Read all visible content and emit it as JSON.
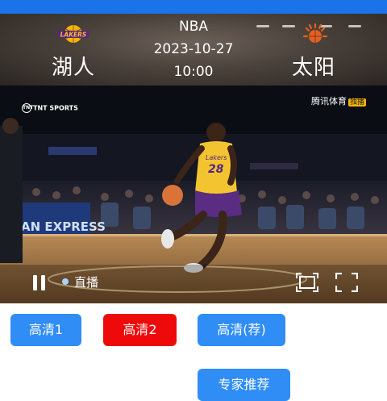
{
  "match": {
    "league": "NBA",
    "date": "2023-10-27",
    "time": "10:00",
    "home_team": "湖人",
    "away_team": "太阳",
    "home_logo_text": "LAKERS",
    "away_logo_text": "SUNS"
  },
  "video": {
    "broadcaster": "TNT SPORTS",
    "source_watermark": "腾讯体育",
    "source_tag": "独播",
    "jersey_text": "Lakers",
    "jersey_number": "28",
    "court_ad": "AN EXPRESS"
  },
  "player_controls": {
    "live_label": "直播",
    "live_dot_color": "#a8d4ff"
  },
  "buttons": {
    "hd1": "高清1",
    "hd2": "高清2",
    "hd_rec": "高清(荐)",
    "expert": "专家推荐"
  },
  "colors": {
    "topbar": "#1a73e8",
    "button_blue": "#2f8df5",
    "button_red": "#ee0a0a"
  }
}
